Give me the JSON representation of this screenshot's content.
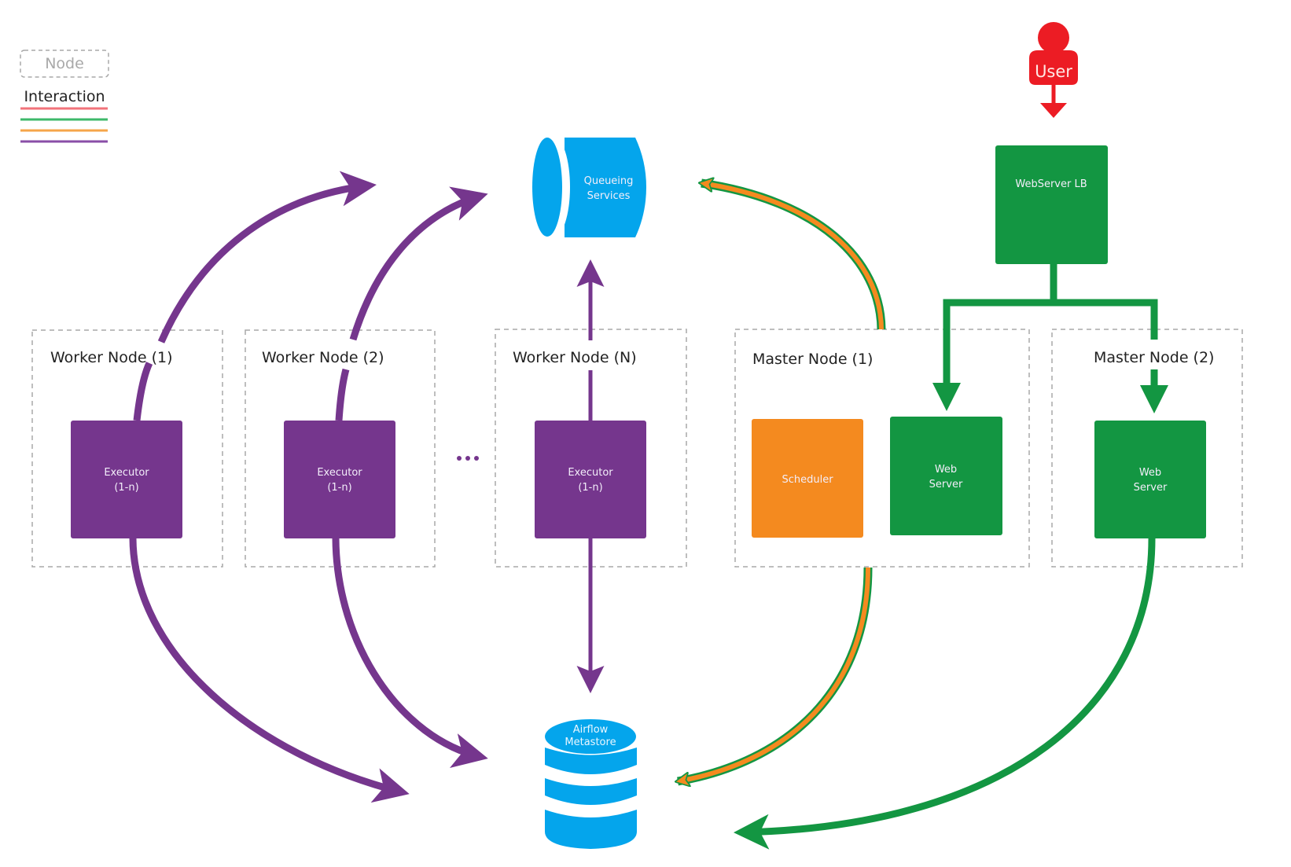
{
  "legend": {
    "node_label": "Node",
    "interaction_label": "Interaction",
    "interaction_colors": [
      "#f2737a",
      "#3db86a",
      "#f5a54a",
      "#8a4ea7"
    ]
  },
  "colors": {
    "purple": "#75368d",
    "green": "#139642",
    "orange": "#f48a1f",
    "blue": "#04a5ec",
    "red": "#ec1c24",
    "node_border": "#a8a8a8"
  },
  "user": {
    "label": "User"
  },
  "queue": {
    "line1": "Queueing",
    "line2": "Services"
  },
  "metastore": {
    "line1": "Airflow",
    "line2": "Metastore"
  },
  "load_balancer": {
    "label": "WebServer LB"
  },
  "worker_nodes": [
    {
      "title": "Worker Node (1)",
      "executor_line1": "Executor",
      "executor_line2": "(1-n)"
    },
    {
      "title": "Worker Node (2)",
      "executor_line1": "Executor",
      "executor_line2": "(1-n)"
    },
    {
      "title": "Worker Node (N)",
      "executor_line1": "Executor",
      "executor_line2": "(1-n)"
    }
  ],
  "ellipsis": "...",
  "master_nodes": [
    {
      "title": "Master Node (1)",
      "scheduler": "Scheduler",
      "webserver_line1": "Web",
      "webserver_line2": "Server"
    },
    {
      "title": "Master Node (2)",
      "webserver_line1": "Web",
      "webserver_line2": "Server"
    }
  ]
}
